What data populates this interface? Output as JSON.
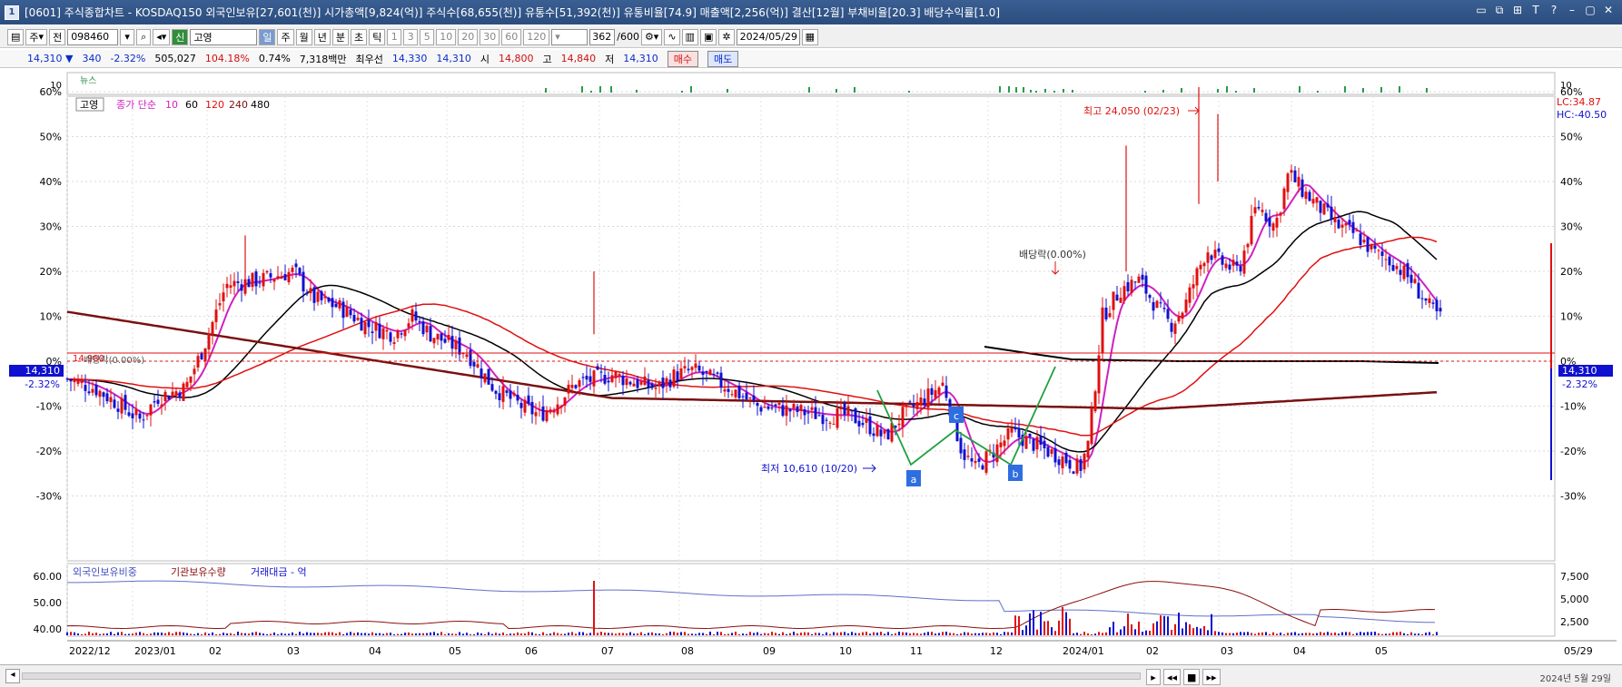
{
  "window": {
    "icon_label": "1",
    "title": "[0601] 주식종합차트 - KOSDAQ150 외국인보유[27,601(천)] 시가총액[9,824(억)] 주식수[68,655(천)] 유통수[51,392(천)] 유통비율[74.9] 매출액[2,256(억)] 결산[12월] 부채비율[20.3] 배당수익률[1.0]",
    "controls": [
      "▭",
      "⧉",
      "⊞",
      "T",
      "?",
      "–",
      "▢",
      "✕"
    ]
  },
  "toolbar": {
    "market": "주",
    "prev_label": "전",
    "code": "098460",
    "badge": "신",
    "name": "고영",
    "periods": [
      "일",
      "주",
      "월",
      "년",
      "분",
      "초",
      "틱"
    ],
    "minutes": [
      "1",
      "3",
      "5",
      "10",
      "20",
      "30",
      "60",
      "120"
    ],
    "count": "362",
    "count_max": "/600",
    "date": "2024/05/29"
  },
  "quote": {
    "price": "14,310 ▼",
    "change": "340",
    "change_pct": "-2.32%",
    "volume": "505,027",
    "volume_ratio": "104.18%",
    "turnover": "0.74%",
    "amount": "7,318백만",
    "best_ask_label": "최우선",
    "best_ask": "14,330",
    "best_bid": "14,310",
    "open_label": "시",
    "open": "14,800",
    "high_label": "고",
    "high": "14,840",
    "low_label": "저",
    "low": "14,310",
    "buy_label": "매수",
    "sell_label": "매도"
  },
  "news": {
    "label": "뉴스",
    "scale": "10",
    "scale_right": "10"
  },
  "price_chart": {
    "legend": {
      "name": "고영",
      "ma_label": "종가 단순",
      "ma10": "10",
      "ma60": "60",
      "ma120": "120",
      "ma240": "240",
      "ma480": "480"
    },
    "y_left": [
      "60%",
      "50%",
      "40%",
      "30%",
      "20%",
      "10%",
      "0%",
      "-10%",
      "-20%",
      "-30%"
    ],
    "y_right": [
      "60%",
      "50%",
      "40%",
      "30%",
      "20%",
      "10%",
      "0%",
      "-10%",
      "-20%",
      "-30%"
    ],
    "lc": "LC:34.87",
    "hc": "HC:-40.50",
    "last_price_tag": "14,310",
    "last_pct_tag": "-2.32%",
    "high_annot": "최고 24,050 (02/23)",
    "low_annot": "최저 10,610 (10/20)",
    "dividend_annot": "배당락(0.00%)",
    "dividend_annot_left": "배당락(0.00%)",
    "left_price_annot": "14,980",
    "pattern_labels": [
      "a",
      "b",
      "c"
    ]
  },
  "sub_chart": {
    "legend_foreign": "외국인보유비중",
    "legend_inst": "기관보유수량",
    "legend_amount": "거래대금 - 억",
    "y_left": [
      "60.00",
      "50.00",
      "40.00"
    ],
    "y_right": [
      "7,500",
      "5,000",
      "2,500"
    ]
  },
  "x_axis": {
    "labels": [
      "2022/12",
      "2023/01",
      "02",
      "03",
      "04",
      "05",
      "06",
      "07",
      "08",
      "09",
      "10",
      "11",
      "12",
      "2024/01",
      "02",
      "03",
      "04",
      "05"
    ],
    "right_label": "05/29"
  },
  "status": {
    "clock": "2024년 5월 29일"
  },
  "colors": {
    "ma10": "#d020c0",
    "ma60": "#000000",
    "ma120": "#e01010",
    "ma240": "#7a1010",
    "up": "#e01010",
    "down": "#1010d0",
    "pattern": "#20a040"
  }
}
